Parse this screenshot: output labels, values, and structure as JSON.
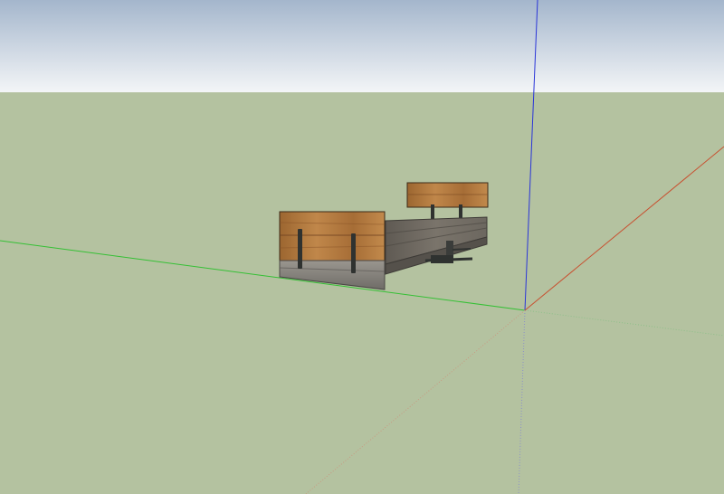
{
  "viewport": {
    "sky_top_color": "#a4b6cc",
    "sky_bottom_color": "#f3f5f7",
    "ground_color": "#b4c2a0"
  },
  "axes": {
    "blue_axis_color": "#2a35d8",
    "green_axis_color": "#35c035",
    "red_axis_color": "#c85030"
  },
  "model": {
    "wood_light": "#b3793f",
    "wood_dark": "#7b4a22",
    "concrete": "#8a8782",
    "deck": "#6f6a62",
    "bracket": "#2f3230"
  }
}
